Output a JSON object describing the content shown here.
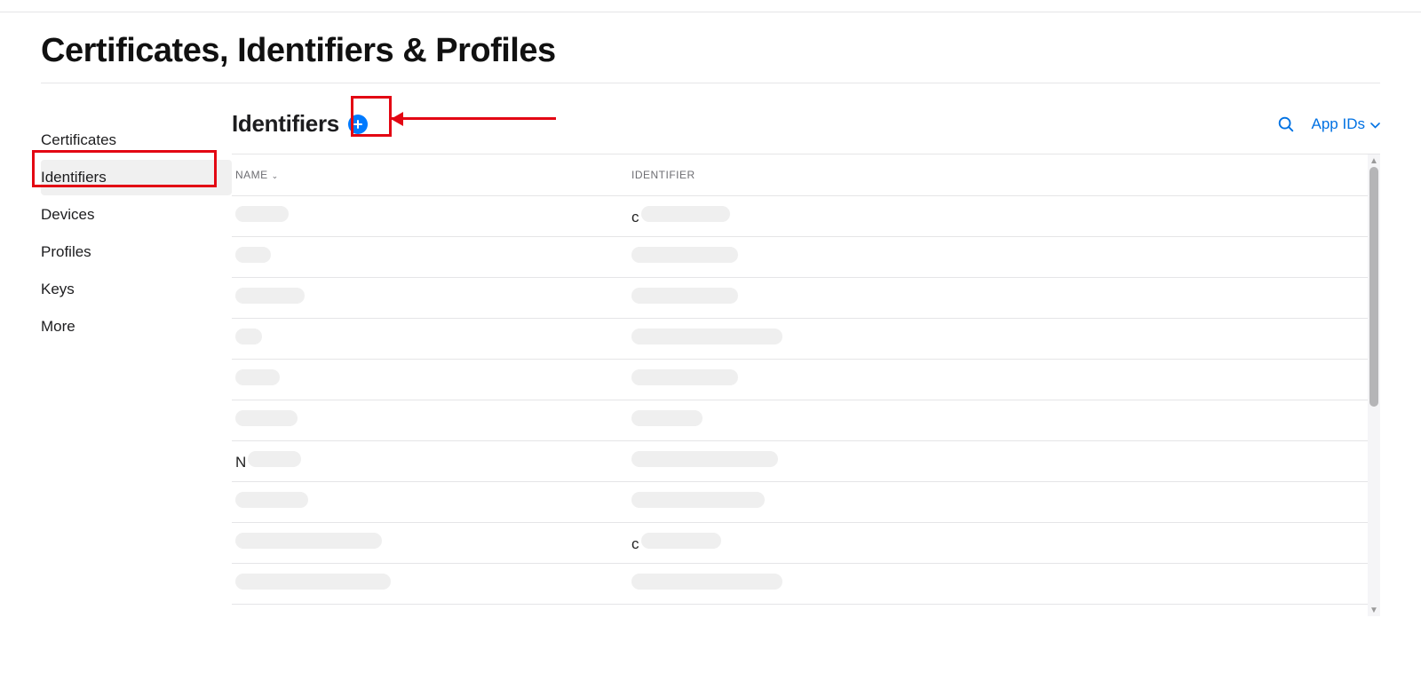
{
  "pageTitle": "Certificates, Identifiers & Profiles",
  "sidebar": {
    "items": [
      {
        "label": "Certificates"
      },
      {
        "label": "Identifiers",
        "active": true
      },
      {
        "label": "Devices"
      },
      {
        "label": "Profiles"
      },
      {
        "label": "Keys"
      },
      {
        "label": "More"
      }
    ]
  },
  "main": {
    "title": "Identifiers",
    "filterLabel": "App IDs"
  },
  "table": {
    "headers": {
      "name": "NAME",
      "identifier": "IDENTIFIER"
    },
    "rows": [
      {
        "nameWidth": 60,
        "idWidth": 100,
        "idPrefix": "c"
      },
      {
        "nameWidth": 40,
        "idWidth": 120
      },
      {
        "nameWidth": 78,
        "idWidth": 120
      },
      {
        "nameWidth": 30,
        "idWidth": 170
      },
      {
        "nameWidth": 50,
        "idWidth": 120
      },
      {
        "nameWidth": 70,
        "idWidth": 80
      },
      {
        "nameWidth": 60,
        "idWidth": 165,
        "namePrefix": "N"
      },
      {
        "nameWidth": 82,
        "idWidth": 150
      },
      {
        "nameWidth": 165,
        "idWidth": 90,
        "idPrefix": "c"
      },
      {
        "nameWidth": 175,
        "idWidth": 170
      }
    ]
  }
}
